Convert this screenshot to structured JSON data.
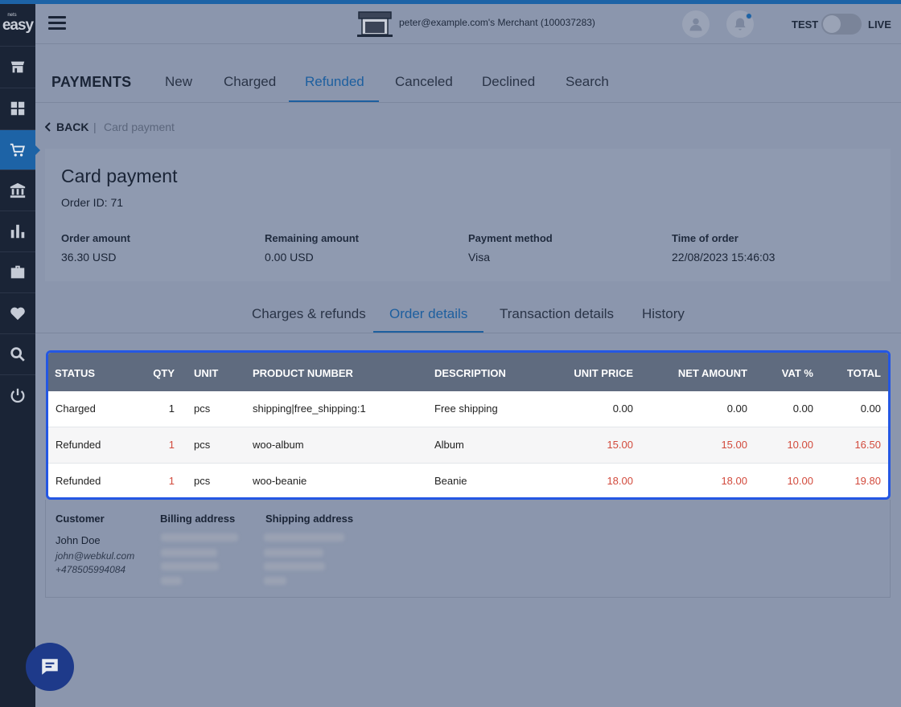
{
  "brand": {
    "small": "nets",
    "big": "easy"
  },
  "header": {
    "merchant": "peter@example.com's Merchant (100037283)",
    "test_label": "TEST",
    "live_label": "LIVE"
  },
  "payments_nav": {
    "title": "PAYMENTS",
    "tabs": [
      {
        "label": "New"
      },
      {
        "label": "Charged"
      },
      {
        "label": "Refunded"
      },
      {
        "label": "Canceled"
      },
      {
        "label": "Declined"
      },
      {
        "label": "Search"
      }
    ],
    "active_tab": "Refunded"
  },
  "breadcrumb": {
    "back": "BACK",
    "separator": "|",
    "current": "Card payment"
  },
  "payment": {
    "title": "Card payment",
    "order_id": "Order ID: 71",
    "fields": [
      {
        "label": "Order amount",
        "value": "36.30 USD"
      },
      {
        "label": "Remaining amount",
        "value": "0.00 USD"
      },
      {
        "label": "Payment method",
        "value": "Visa"
      },
      {
        "label": "Time of order",
        "value": "22/08/2023 15:46:03"
      }
    ]
  },
  "detail_tabs": {
    "tabs": [
      {
        "label": "Charges & refunds"
      },
      {
        "label": "Order details"
      },
      {
        "label": "Transaction details"
      },
      {
        "label": "History"
      }
    ],
    "active_tab": "Order details"
  },
  "order_table": {
    "headers": [
      "STATUS",
      "QTY",
      "UNIT",
      "PRODUCT NUMBER",
      "DESCRIPTION",
      "UNIT PRICE",
      "NET AMOUNT",
      "VAT %",
      "TOTAL"
    ],
    "rows": [
      {
        "status": "Charged",
        "qty": "1",
        "unit": "pcs",
        "product_number": "shipping|free_shipping:1",
        "description": "Free shipping",
        "unit_price": "0.00",
        "net_amount": "0.00",
        "vat": "0.00",
        "total": "0.00"
      },
      {
        "status": "Refunded",
        "qty": "1",
        "unit": "pcs",
        "product_number": "woo-album",
        "description": "Album",
        "unit_price": "15.00",
        "net_amount": "15.00",
        "vat": "10.00",
        "total": "16.50"
      },
      {
        "status": "Refunded",
        "qty": "1",
        "unit": "pcs",
        "product_number": "woo-beanie",
        "description": "Beanie",
        "unit_price": "18.00",
        "net_amount": "18.00",
        "vat": "10.00",
        "total": "19.80"
      }
    ],
    "refund_color": "#d24a3c"
  },
  "customer": {
    "customer_heading": "Customer",
    "billing_heading": "Billing address",
    "shipping_heading": "Shipping address",
    "name": "John Doe",
    "email": "john@webkul.com",
    "phone": "+478505994084"
  },
  "colors": {
    "accent": "#1d63a6",
    "sidebar": "#1a2436",
    "highlight_border": "#2457e3"
  }
}
